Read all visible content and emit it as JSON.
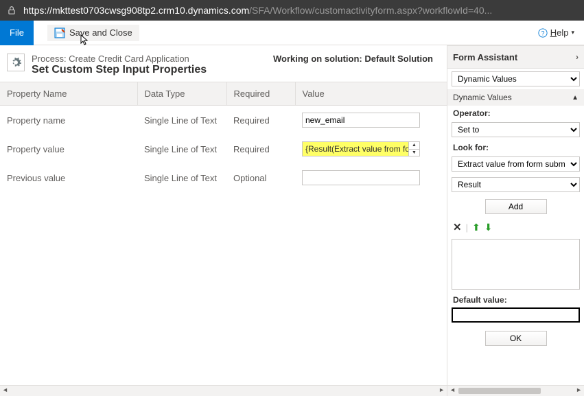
{
  "url": {
    "host": "https://mkttest0703cwsg908tp2.crm10.dynamics.com",
    "path": "/SFA/Workflow/customactivityform.aspx?workflowId=40..."
  },
  "topbar": {
    "file": "File",
    "save_close": "Save and Close",
    "help": "Help"
  },
  "header": {
    "process_line": "Process: Create Credit Card Application",
    "title": "Set Custom Step Input Properties",
    "solution": "Working on solution: Default Solution"
  },
  "columns": {
    "name": "Property Name",
    "datatype": "Data Type",
    "required": "Required",
    "value": "Value"
  },
  "rows": [
    {
      "name": "Property name",
      "datatype": "Single Line of Text",
      "required": "Required",
      "value": "new_email",
      "kind": "input"
    },
    {
      "name": "Property value",
      "datatype": "Single Line of Text",
      "required": "Required",
      "value": "{Result(Extract value from form",
      "kind": "token"
    },
    {
      "name": "Previous value",
      "datatype": "Single Line of Text",
      "required": "Optional",
      "value": "",
      "kind": "input"
    }
  ],
  "assist": {
    "title": "Form Assistant",
    "dynamic_values_select": "Dynamic Values",
    "dynamic_values_section": "Dynamic Values",
    "operator_label": "Operator:",
    "operator_value": "Set to",
    "lookfor_label": "Look for:",
    "lookfor_entity": "Extract value from form submission",
    "lookfor_attr": "Result",
    "add_btn": "Add",
    "default_label": "Default value:",
    "ok_btn": "OK"
  }
}
